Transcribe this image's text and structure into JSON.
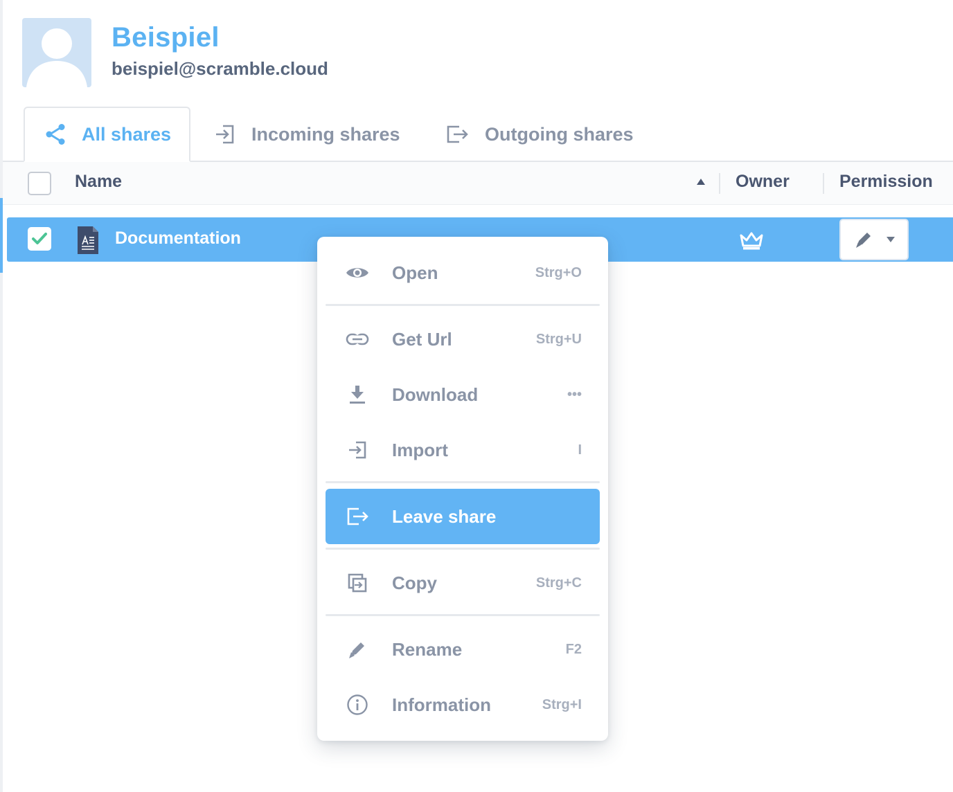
{
  "profile": {
    "name": "Beispiel",
    "email": "beispiel@scramble.cloud"
  },
  "tabs": [
    {
      "label": "All shares",
      "icon": "share-icon",
      "active": true
    },
    {
      "label": "Incoming shares",
      "icon": "incoming-icon",
      "active": false
    },
    {
      "label": "Outgoing shares",
      "icon": "outgoing-icon",
      "active": false
    }
  ],
  "table": {
    "columns": {
      "name": "Name",
      "owner": "Owner",
      "permission": "Permission"
    },
    "sort": {
      "column": "Name",
      "direction": "ascending"
    },
    "rows": [
      {
        "name": "Documentation",
        "selected": true,
        "file_icon": "document-icon",
        "owner_icon": "crown-icon",
        "permission_icon": "pencil-icon"
      }
    ]
  },
  "context_menu": {
    "items": [
      {
        "label": "Open",
        "shortcut": "Strg+O",
        "icon": "eye-icon"
      },
      {
        "label": "Get Url",
        "shortcut": "Strg+U",
        "icon": "link-icon"
      },
      {
        "label": "Download",
        "shortcut": "•••",
        "icon": "download-icon"
      },
      {
        "label": "Import",
        "shortcut": "I",
        "icon": "import-icon"
      },
      {
        "label": "Leave share",
        "shortcut": "",
        "icon": "leave-icon",
        "highlighted": true
      },
      {
        "label": "Copy",
        "shortcut": "Strg+C",
        "icon": "copy-icon"
      },
      {
        "label": "Rename",
        "shortcut": "F2",
        "icon": "pencil-icon"
      },
      {
        "label": "Information",
        "shortcut": "Strg+I",
        "icon": "info-icon"
      }
    ]
  },
  "colors": {
    "accent": "#62b4f4",
    "text": "#4a5670",
    "muted": "#8a94a6",
    "check": "#4cc495"
  }
}
